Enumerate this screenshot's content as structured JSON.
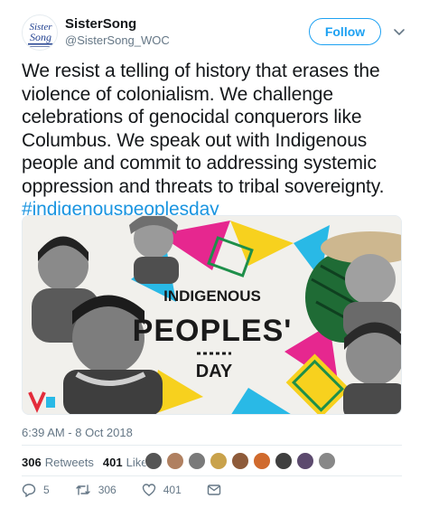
{
  "author": {
    "name": "SisterSong",
    "handle": "@SisterSong_WOC",
    "avatar_text": "Sister Song"
  },
  "follow_label": "Follow",
  "tweet": {
    "text": "We resist a telling of history that erases the violence of colonialism. We challenge celebrations of genocidal conquerors like Columbus. We speak out with Indigenous people and commit to addressing systemic oppression and threats to tribal sovereignty.",
    "hashtag": "#indigenouspeoplesday"
  },
  "media": {
    "line1": "INDIGENOUS",
    "line2": "PEOPLES'",
    "line3": "DAY"
  },
  "timestamp": "6:39 AM - 8 Oct 2018",
  "stats": {
    "retweets_count": "306",
    "retweets_label": "Retweets",
    "likes_count": "401",
    "likes_label": "Likes"
  },
  "actions": {
    "replies": "5",
    "retweets": "306",
    "likes": "401"
  },
  "colors": {
    "accent": "#1da1f2",
    "hashtag": "#1b95e0",
    "muted": "#657786",
    "banner_magenta": "#e6278f",
    "banner_cyan": "#29b9e6",
    "banner_yellow": "#f7d11e"
  },
  "icons": [
    "caret-down-icon",
    "reply-icon",
    "retweet-icon",
    "heart-icon",
    "message-icon"
  ]
}
